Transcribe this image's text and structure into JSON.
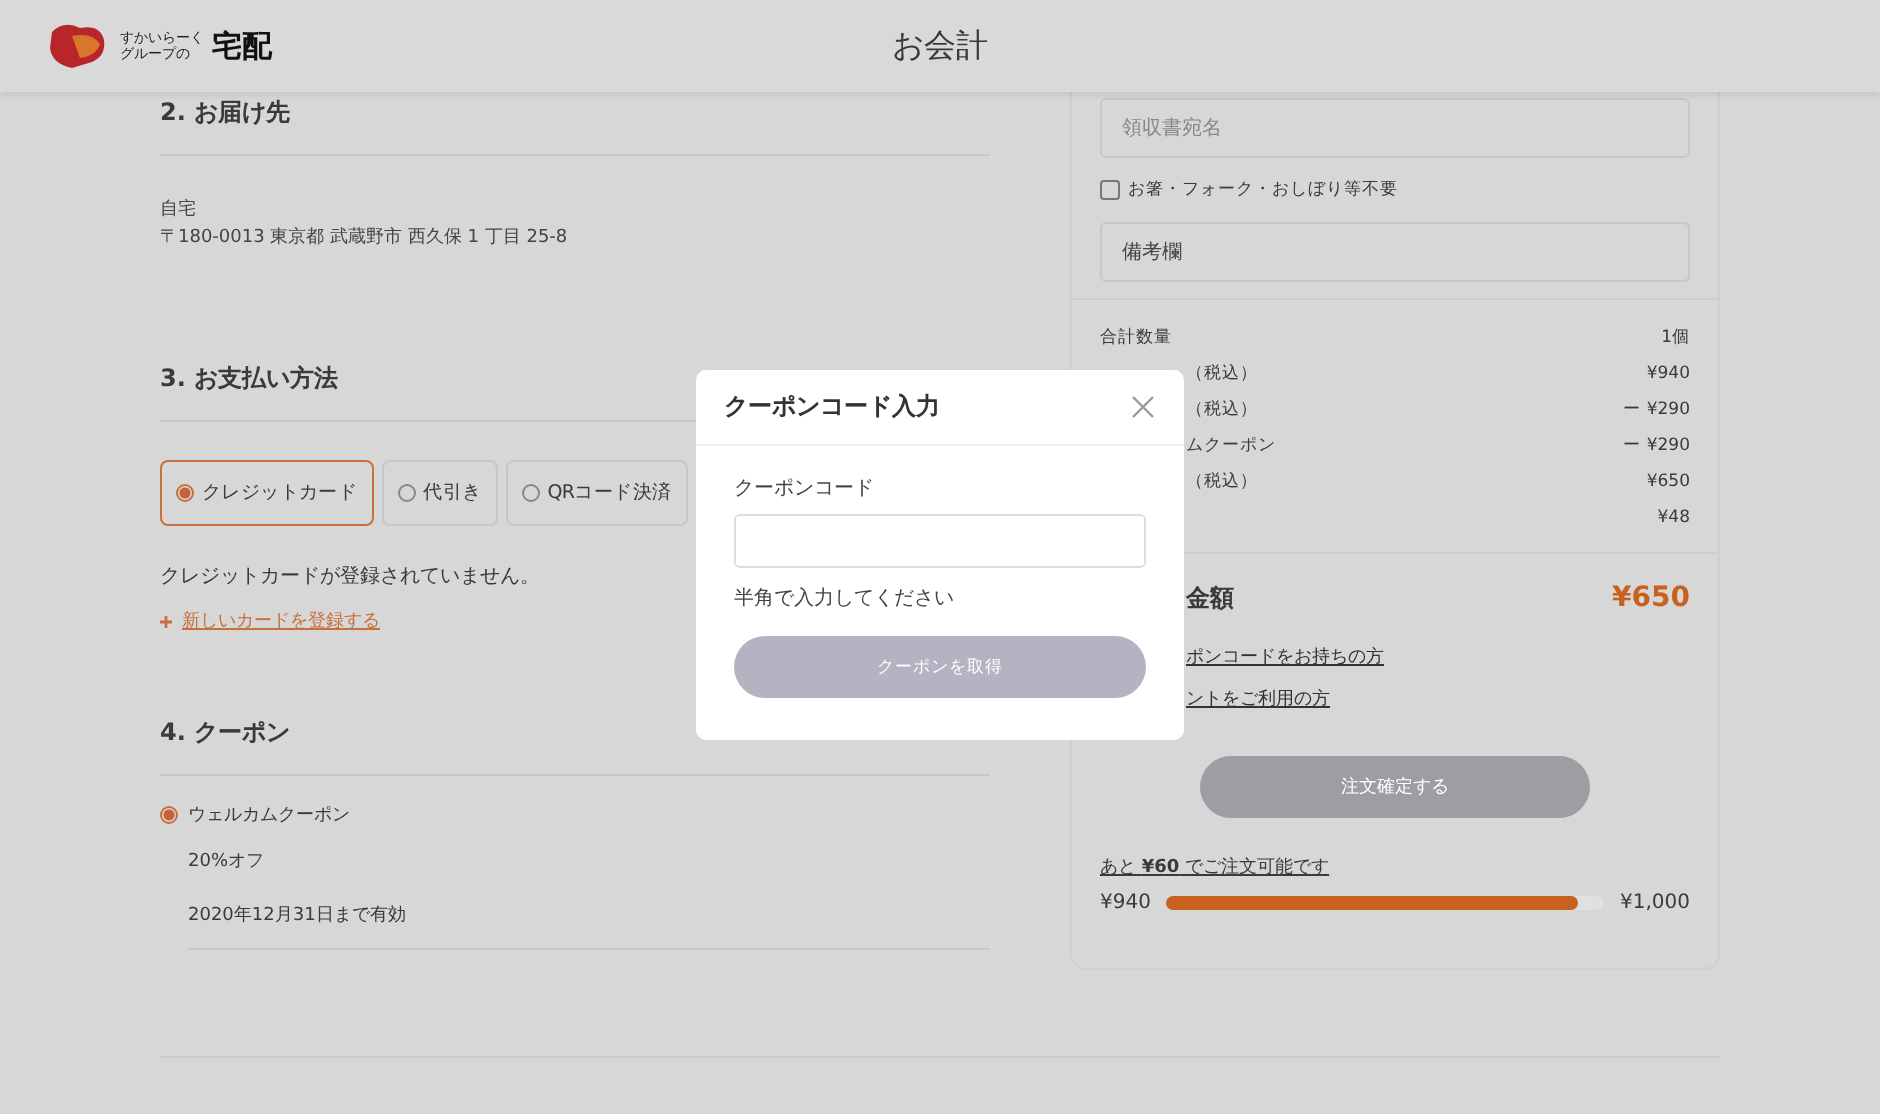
{
  "header": {
    "logo_lines": [
      "すかいらーく",
      "グループの",
      "宅配"
    ],
    "title": "お会計"
  },
  "delivery": {
    "heading": "2. お届け先",
    "name": "自宅",
    "address": "〒180-0013 東京都 武蔵野市 西久保 1 丁目 25-8"
  },
  "payment": {
    "heading": "3. お支払い方法",
    "methods": [
      {
        "label": "クレジットカード",
        "selected": true
      },
      {
        "label": "代引き",
        "selected": false
      },
      {
        "label": "QRコード決済",
        "selected": false
      }
    ],
    "message": "クレジットカードが登録されていません。",
    "add_card_link": "新しいカードを登録する"
  },
  "coupon": {
    "heading": "4. クーポン",
    "coupons": [
      {
        "name": "ウェルカムクーポン",
        "selected": true,
        "discount": "20%オフ",
        "expiry": "2020年12月31日まで有効"
      }
    ]
  },
  "order_panel": {
    "receipt_name": {
      "placeholder": "領収書宛名"
    },
    "cutlery_checkbox": {
      "label": "お箸・フォーク・おしぼり等不要",
      "checked": false
    },
    "notes": {
      "placeholder": "備考欄"
    },
    "summary": [
      {
        "label": "合計数量",
        "value": "1個"
      },
      {
        "label": "（税込）",
        "value": "¥940"
      },
      {
        "label": "（税込）",
        "value": "ー ¥290"
      },
      {
        "label": "ムクーポン",
        "value": "ー ¥290"
      },
      {
        "label": "（税込）",
        "value": "¥650"
      },
      {
        "value": "¥48"
      }
    ],
    "total": {
      "label": "金額",
      "value": "¥650"
    },
    "links": [
      "ポンコードをお持ちの方",
      "ントをご利用の方"
    ],
    "order_button": {
      "label": "注文確定する",
      "disabled": true
    },
    "minimum": {
      "message": "あと **¥60** でご注文可能です",
      "start": "¥940",
      "end": "¥1,000",
      "level": 0.94
    }
  },
  "modal": {
    "title": "クーポンコード入力",
    "field_label": "クーポンコード",
    "hint": "半角で入力してください",
    "button": {
      "label": "クーポンを取得",
      "disabled": true
    }
  }
}
